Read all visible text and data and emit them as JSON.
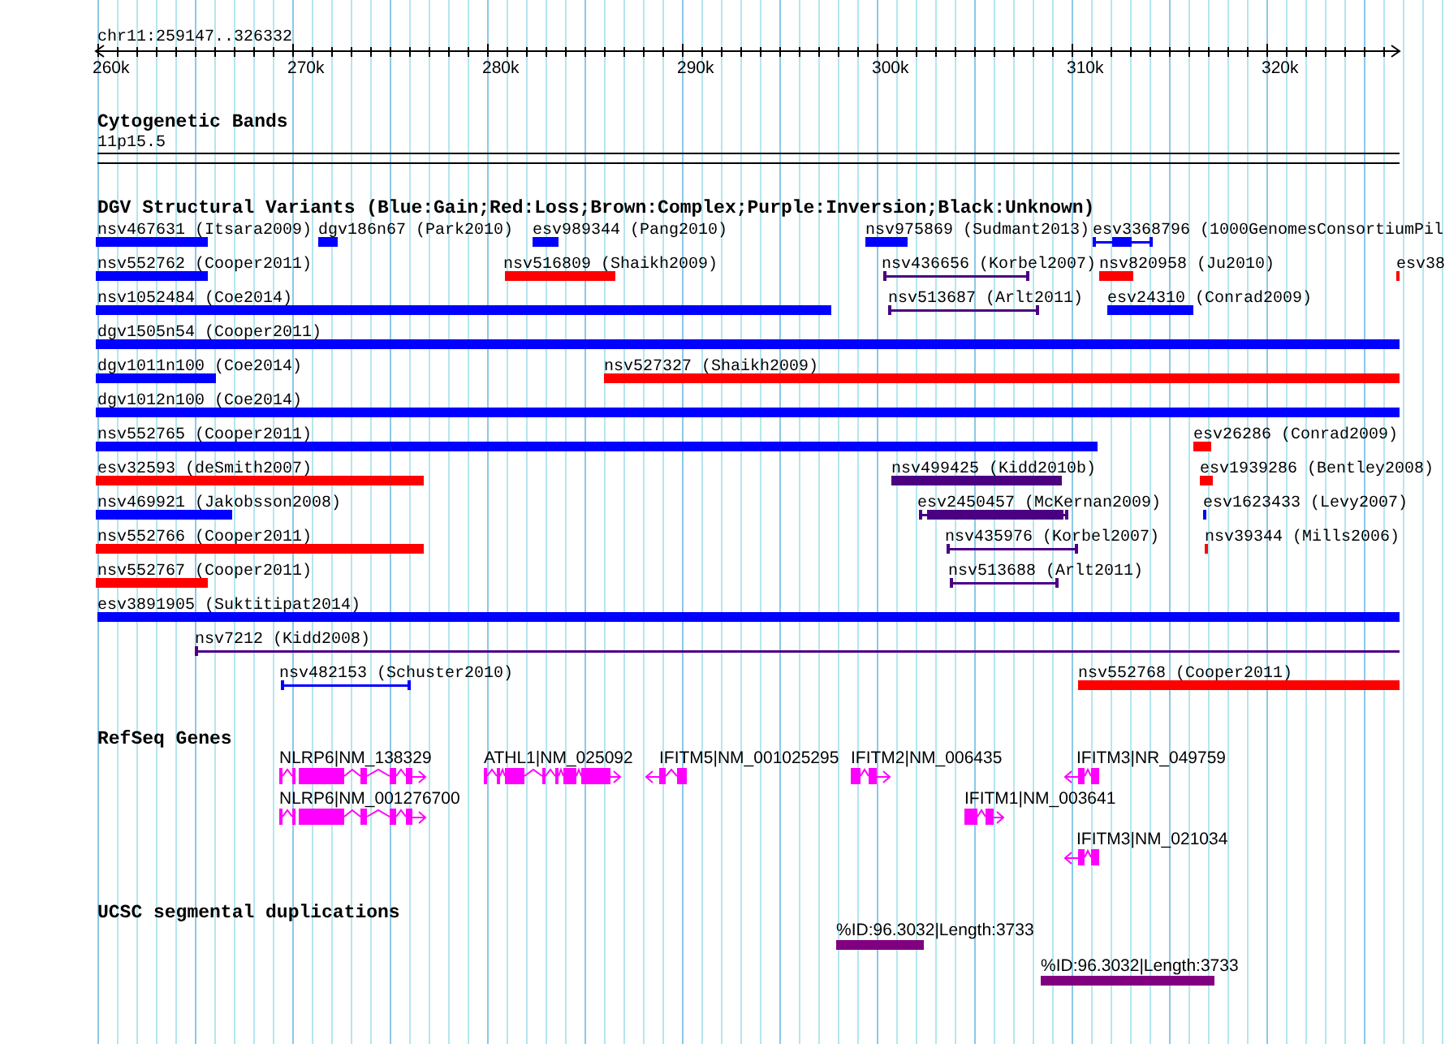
{
  "ruler": {
    "location": "chr11:259147..326332",
    "ticks": [
      "260k",
      "270k",
      "280k",
      "290k",
      "300k",
      "310k",
      "320k"
    ]
  },
  "tracks": [
    {
      "kind": "bands",
      "title": "Cytogenetic Bands",
      "features": [
        {
          "label": "11p15.5"
        }
      ]
    },
    {
      "kind": "variants",
      "title": "DGV Structural Variants (Blue:Gain;Red:Loss;Brown:Complex;Purple:Inversion;Black:Unknown)",
      "features": [
        {
          "label": "nsv467631 (Itsara2009)",
          "kind": "bar",
          "color": "#0000ff"
        },
        {
          "label": "dgv186n67 (Park2010)",
          "kind": "bar",
          "color": "#0000ff"
        },
        {
          "label": "esv989344 (Pang2010)",
          "kind": "bar",
          "color": "#0000ff"
        },
        {
          "label": "nsv975869 (Sudmant2013)",
          "kind": "bar",
          "color": "#0000ff"
        },
        {
          "label": "esv3368796 (1000GenomesConsortiumPil",
          "kind": "thick-span",
          "color": "#0000ff"
        },
        {
          "label": "nsv552762 (Cooper2011)",
          "kind": "bar",
          "color": "#0000ff"
        },
        {
          "label": "nsv516809 (Shaikh2009)",
          "kind": "bar",
          "color": "#ff0000"
        },
        {
          "label": "nsv436656 (Korbel2007)",
          "kind": "span",
          "color": "#4b0082"
        },
        {
          "label": "nsv820958 (Ju2010)",
          "kind": "bar",
          "color": "#ff0000"
        },
        {
          "label": "esv38",
          "kind": "bar",
          "color": "#ff0000"
        },
        {
          "label": "nsv1052484 (Coe2014)",
          "kind": "bar",
          "color": "#0000ff"
        },
        {
          "label": "nsv513687 (Arlt2011)",
          "kind": "span",
          "color": "#4b0082"
        },
        {
          "label": "esv24310 (Conrad2009)",
          "kind": "bar",
          "color": "#0000ff"
        },
        {
          "label": "dgv1505n54 (Cooper2011)",
          "kind": "bar",
          "color": "#0000ff"
        },
        {
          "label": "dgv1011n100 (Coe2014)",
          "kind": "bar",
          "color": "#0000ff"
        },
        {
          "label": "nsv527327 (Shaikh2009)",
          "kind": "bar",
          "color": "#ff0000"
        },
        {
          "label": "dgv1012n100 (Coe2014)",
          "kind": "bar",
          "color": "#0000ff"
        },
        {
          "label": "nsv552765 (Cooper2011)",
          "kind": "bar",
          "color": "#0000ff"
        },
        {
          "label": "esv26286 (Conrad2009)",
          "kind": "bar",
          "color": "#ff0000"
        },
        {
          "label": "esv32593 (deSmith2007)",
          "kind": "bar",
          "color": "#ff0000"
        },
        {
          "label": "nsv499425 (Kidd2010b)",
          "kind": "bar",
          "color": "#4b0082"
        },
        {
          "label": "esv1939286 (Bentley2008)",
          "kind": "bar",
          "color": "#ff0000"
        },
        {
          "label": "nsv469921 (Jakobsson2008)",
          "kind": "bar",
          "color": "#0000ff"
        },
        {
          "label": "esv2450457 (McKernan2009)",
          "kind": "thick-span",
          "color": "#4b0082"
        },
        {
          "label": "esv1623433 (Levy2007)",
          "kind": "bar",
          "color": "#0000ff"
        },
        {
          "label": "nsv552766 (Cooper2011)",
          "kind": "bar",
          "color": "#ff0000"
        },
        {
          "label": "nsv435976 (Korbel2007)",
          "kind": "span",
          "color": "#4b0082"
        },
        {
          "label": "nsv39344 (Mills2006)",
          "kind": "bar",
          "color": "#ff0000"
        },
        {
          "label": "nsv552767 (Cooper2011)",
          "kind": "bar",
          "color": "#ff0000"
        },
        {
          "label": "nsv513688 (Arlt2011)",
          "kind": "span",
          "color": "#4b0082"
        },
        {
          "label": "esv3891905 (Suktitipat2014)",
          "kind": "bar",
          "color": "#0000ff"
        },
        {
          "label": "nsv7212 (Kidd2008)",
          "kind": "span",
          "color": "#4b0082"
        },
        {
          "label": "nsv482153 (Schuster2010)",
          "kind": "span",
          "color": "#0000ff"
        },
        {
          "label": "nsv552768 (Cooper2011)",
          "kind": "bar",
          "color": "#ff0000"
        }
      ]
    },
    {
      "kind": "genes",
      "title": "RefSeq Genes",
      "features": [
        {
          "label": "NLRP6|NM_138329",
          "reverse": false
        },
        {
          "label": "ATHL1|NM_025092",
          "reverse": false
        },
        {
          "label": "IFITM5|NM_001025295",
          "reverse": true
        },
        {
          "label": "IFITM2|NM_006435",
          "reverse": false
        },
        {
          "label": "IFITM3|NR_049759",
          "reverse": true
        },
        {
          "label": "NLRP6|NM_001276700",
          "reverse": false
        },
        {
          "label": "IFITM1|NM_003641",
          "reverse": false
        },
        {
          "label": "IFITM3|NM_021034",
          "reverse": true
        }
      ]
    },
    {
      "kind": "segdups",
      "title": "UCSC segmental duplications",
      "features": [
        {
          "label": "%ID:96.3032|Length:3733"
        },
        {
          "label": "%ID:96.3032|Length:3733"
        }
      ]
    }
  ]
}
